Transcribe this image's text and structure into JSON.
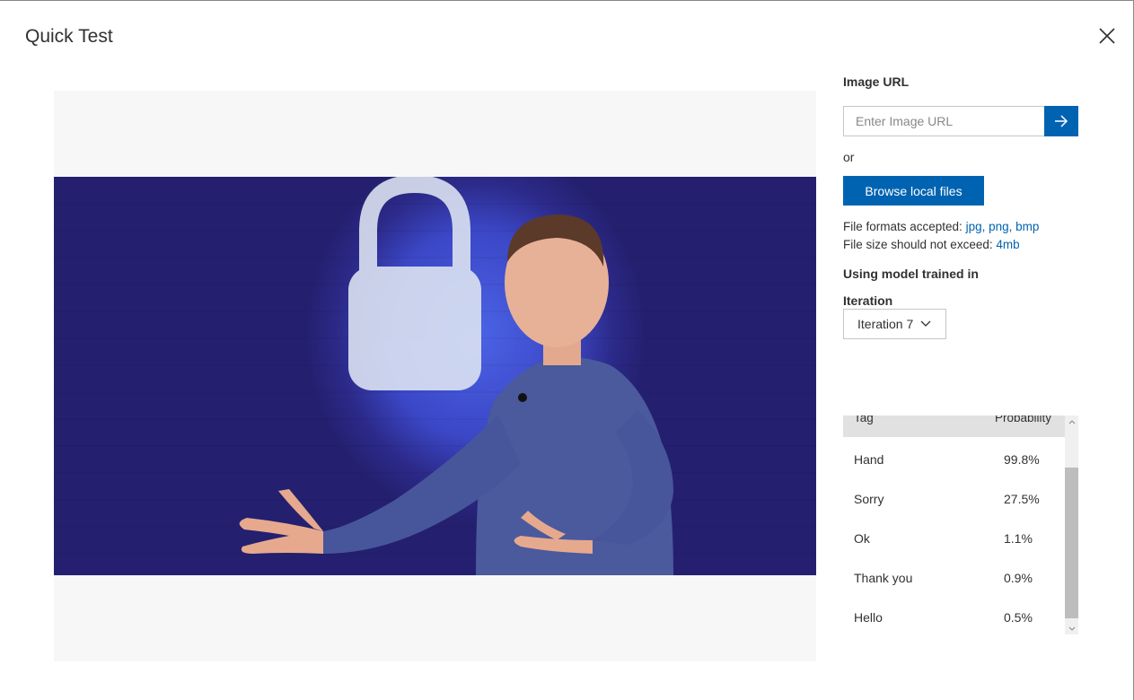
{
  "dialog": {
    "title": "Quick Test",
    "close_icon": "close-icon"
  },
  "panel": {
    "image_url_label": "Image URL",
    "url_input_placeholder": "Enter Image URL",
    "url_input_value": "",
    "go_icon": "arrow-right-icon",
    "or_text": "or",
    "browse_button_label": "Browse local files",
    "file_formats_prefix": "File formats accepted:",
    "file_formats_value": "jpg, png, bmp",
    "file_size_prefix": "File size should not exceed:",
    "file_size_value": "4mb",
    "model_label": "Using model trained in",
    "iteration_label": "Iteration",
    "iteration_selected": "Iteration 7"
  },
  "results": {
    "columns": [
      "Tag",
      "Probability"
    ],
    "rows": [
      {
        "tag": "Hand",
        "probability": "99.8%"
      },
      {
        "tag": "Sorry",
        "probability": "27.5%"
      },
      {
        "tag": "Ok",
        "probability": "1.1%"
      },
      {
        "tag": "Thank you",
        "probability": "0.9%"
      },
      {
        "tag": "Hello",
        "probability": "0.5%"
      }
    ]
  },
  "colors": {
    "accent": "#0063b1",
    "header_bg": "#e1e1e1",
    "preview_bg": "#f7f7f7"
  }
}
